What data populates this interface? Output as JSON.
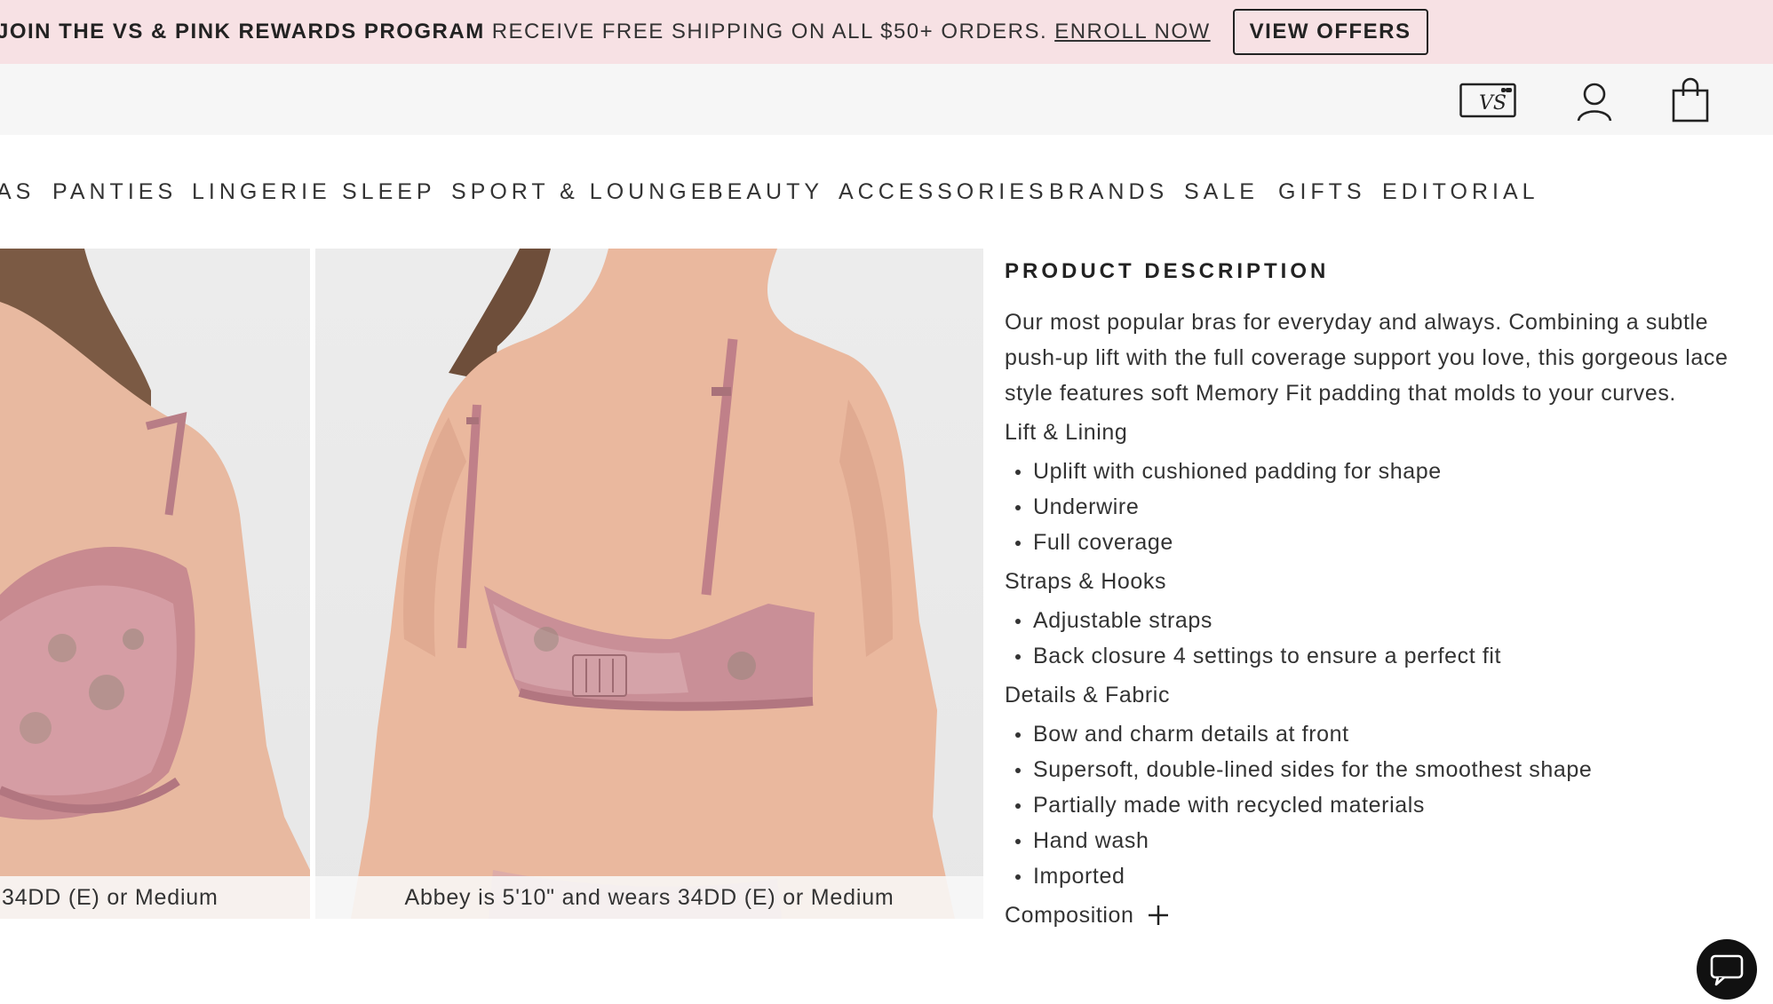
{
  "promo": {
    "lead": "JOIN THE VS & PINK REWARDS PROGRAM",
    "text": "RECEIVE FREE SHIPPING ON ALL $50+ ORDERS.",
    "enroll": "ENROLL NOW",
    "offers_button": "VIEW OFFERS",
    "background": "#f7e1e4"
  },
  "header": {
    "icons": [
      "vs-card-icon",
      "account-icon",
      "shopping-bag-icon"
    ],
    "card_logo_text": "VS"
  },
  "nav": {
    "items": [
      "AS",
      "PANTIES",
      "LINGERIE",
      "SLEEP",
      "SPORT & LOUNGE",
      "BEAUTY",
      "ACCESSORIES",
      "BRANDS",
      "SALE",
      "GIFTS",
      "EDITORIAL"
    ]
  },
  "gallery": {
    "captions": [
      "34DD (E) or Medium",
      "Abbey is 5'10\" and wears 34DD (E) or Medium"
    ]
  },
  "product": {
    "title": "PRODUCT DESCRIPTION",
    "intro_lines": [
      "Our most popular bras for everyday and always. Combining a subtle",
      "push-up lift with the full coverage support you love, this gorgeous lace",
      "style features soft Memory Fit padding that molds to your curves."
    ],
    "sections": [
      {
        "heading": "Lift & Lining",
        "bullets": [
          "Uplift with cushioned padding for shape",
          "Underwire",
          "Full coverage"
        ]
      },
      {
        "heading": "Straps & Hooks",
        "bullets": [
          "Adjustable straps",
          "Back closure 4 settings to ensure a perfect fit"
        ]
      },
      {
        "heading": "Details & Fabric",
        "bullets": [
          "Bow and charm details at front",
          "Supersoft, double-lined sides for the smoothest shape",
          "Partially made with recycled materials",
          "Hand wash",
          "Imported"
        ]
      }
    ],
    "composition_label": "Composition"
  },
  "chat": {
    "icon": "chat-icon"
  }
}
